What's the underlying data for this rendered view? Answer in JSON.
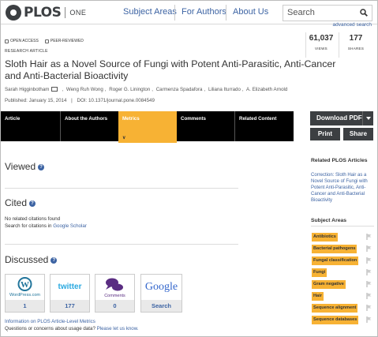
{
  "header": {
    "logo_text": "PLOS",
    "logo_sub": "ONE",
    "nav": [
      "Subject Areas",
      "For Authors",
      "About Us"
    ],
    "search_placeholder": "Search",
    "advanced_search": "advanced search"
  },
  "article": {
    "badges": [
      "OPEN ACCESS",
      "PEER-REVIEWED"
    ],
    "type": "RESEARCH ARTICLE",
    "views_value": "61,037",
    "views_label": "VIEWS",
    "shares_value": "177",
    "shares_label": "SHARES",
    "title": "Sloth Hair as a Novel Source of Fungi with Potent Anti-Parasitic, Anti-Cancer and Anti-Bacterial Bioactivity",
    "authors": [
      "Sarah Higginbotham",
      "Weng Ruh Wong",
      "Roger G. Linington",
      "Carmenza Spadafora",
      "Liliana Iturrado",
      "A. Elizabeth Arnold"
    ],
    "published": "Published: January 15, 2014",
    "doi": "DOI: 10.1371/journal.pone.0084549"
  },
  "tabs": [
    {
      "label": "Article"
    },
    {
      "label": "About the Authors"
    },
    {
      "label": "Metrics",
      "active": true
    },
    {
      "label": "Comments"
    },
    {
      "label": "Related Content"
    }
  ],
  "actions": {
    "download_pdf": "Download PDF",
    "print": "Print",
    "share": "Share"
  },
  "metrics": {
    "viewed_heading": "Viewed",
    "cited_heading": "Cited",
    "cited_none": "No related citations found",
    "cited_search_prefix": "Search for citations in ",
    "cited_search_link": "Google Scholar",
    "discussed_heading": "Discussed",
    "sources": [
      {
        "name": "WordPress.com",
        "count": "1"
      },
      {
        "name": "twitter",
        "count": "177"
      },
      {
        "name": "Comments",
        "count": "0"
      },
      {
        "name": "Google",
        "count": "Search"
      }
    ],
    "info_link": "Information on PLOS Article-Level Metrics",
    "questions_prefix": "Questions or concerns about usage data? ",
    "questions_link": "Please let us know."
  },
  "sidebar": {
    "related_title": "Related PLOS Articles",
    "related_link": "Correction: Sloth Hair as a Novel Source of Fungi with Potent Anti-Parasitic, Anti-Cancer and Anti-Bacterial Bioactivity",
    "subject_title": "Subject Areas",
    "subjects": [
      "Antibiotics",
      "Bacterial pathogens",
      "Fungal classification",
      "Fungi",
      "Gram negative",
      "Hair",
      "Sequence alignment",
      "Sequence databases"
    ]
  },
  "colors": {
    "accent": "#f7b234",
    "link": "#3c63a3",
    "dark": "#3c3f42"
  }
}
